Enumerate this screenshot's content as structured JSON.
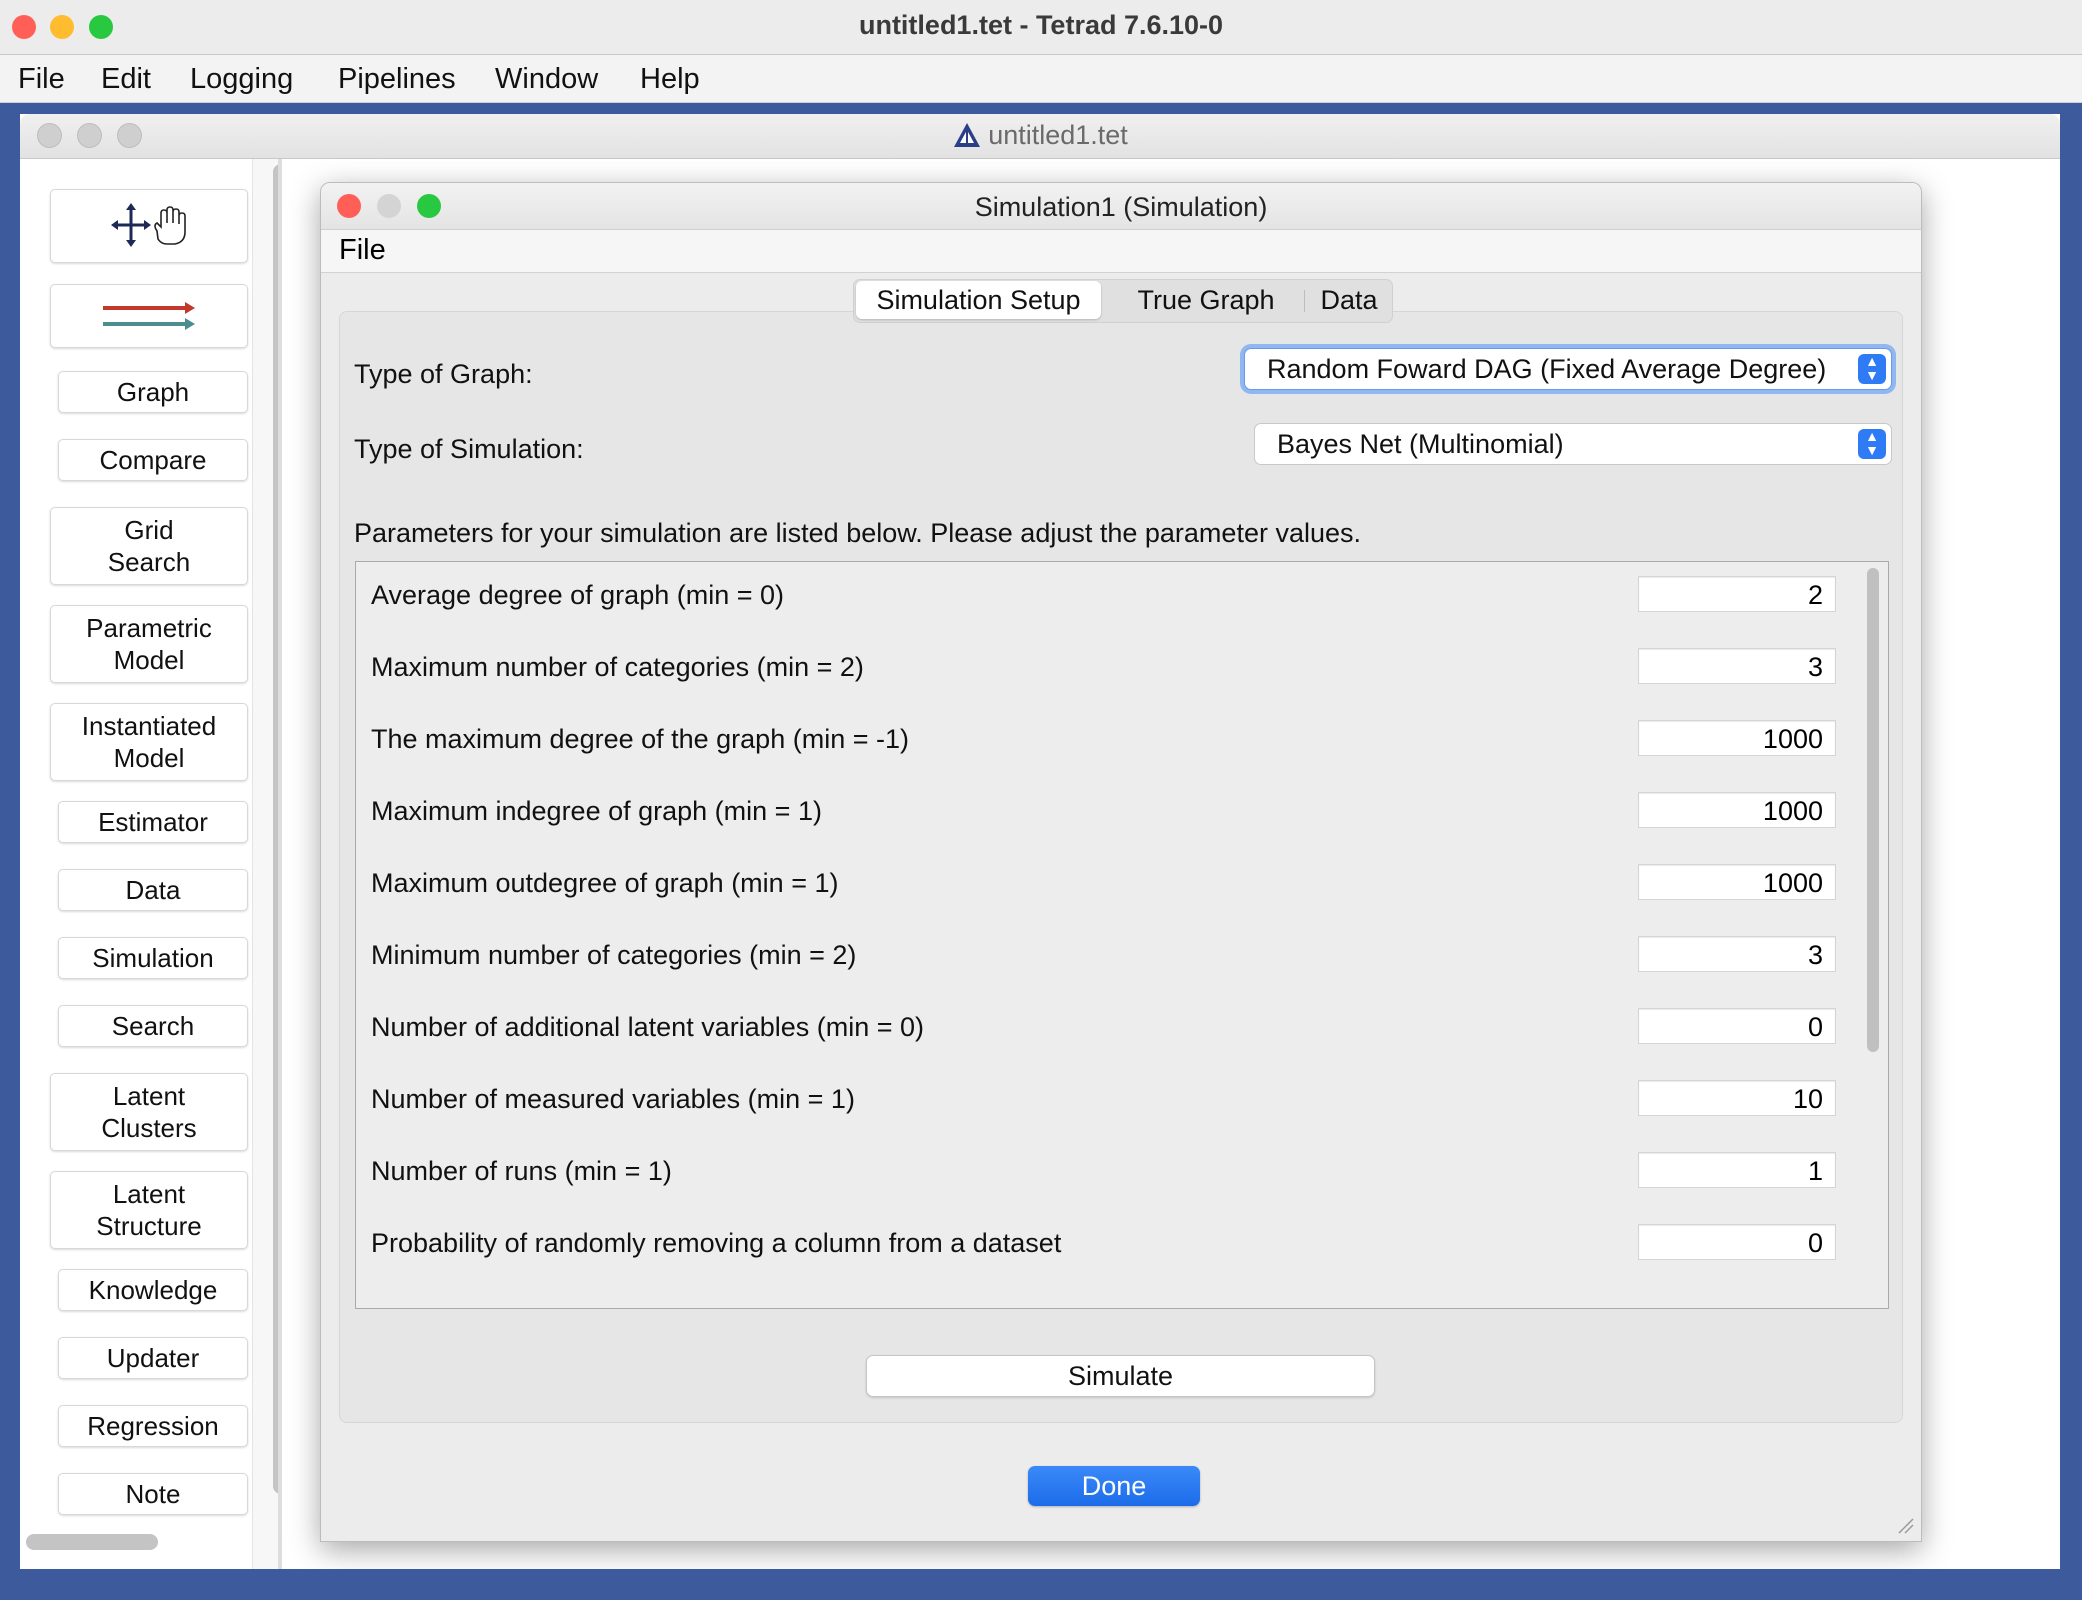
{
  "app": {
    "window_title": "untitled1.tet - Tetrad 7.6.10-0",
    "menu": [
      "File",
      "Edit",
      "Logging",
      "Pipelines",
      "Window",
      "Help"
    ]
  },
  "inner_frame": {
    "title": "untitled1.tet"
  },
  "toolbox": {
    "items": [
      {
        "line1": "Graph",
        "line2": ""
      },
      {
        "line1": "Compare",
        "line2": ""
      },
      {
        "line1": "Grid",
        "line2": "Search"
      },
      {
        "line1": "Parametric",
        "line2": "Model"
      },
      {
        "line1": "Instantiated",
        "line2": "Model"
      },
      {
        "line1": "Estimator",
        "line2": ""
      },
      {
        "line1": "Data",
        "line2": ""
      },
      {
        "line1": "Simulation",
        "line2": ""
      },
      {
        "line1": "Search",
        "line2": ""
      },
      {
        "line1": "Latent",
        "line2": "Clusters"
      },
      {
        "line1": "Latent",
        "line2": "Structure"
      },
      {
        "line1": "Knowledge",
        "line2": ""
      },
      {
        "line1": "Updater",
        "line2": ""
      },
      {
        "line1": "Regression",
        "line2": ""
      },
      {
        "line1": "Note",
        "line2": ""
      }
    ]
  },
  "dialog": {
    "title": "Simulation1 (Simulation)",
    "menu_file": "File",
    "tabs": [
      "Simulation Setup",
      "True Graph",
      "Data"
    ],
    "active_tab": "Simulation Setup",
    "graph_type_label": "Type of Graph:",
    "graph_type_value": "Random Foward DAG (Fixed Average Degree)",
    "sim_type_label": "Type of Simulation:",
    "sim_type_value": "Bayes Net (Multinomial)",
    "params_intro": "Parameters for your simulation are listed below. Please adjust the parameter values.",
    "params": [
      {
        "label": "Average degree of graph (min = 0)",
        "value": "2"
      },
      {
        "label": "Maximum number of categories (min = 2)",
        "value": "3"
      },
      {
        "label": "The maximum degree of the graph (min = -1)",
        "value": "1000"
      },
      {
        "label": "Maximum indegree of graph (min = 1)",
        "value": "1000"
      },
      {
        "label": "Maximum outdegree of graph (min = 1)",
        "value": "1000"
      },
      {
        "label": "Minimum number of categories (min = 2)",
        "value": "3"
      },
      {
        "label": "Number of additional latent variables (min = 0)",
        "value": "0"
      },
      {
        "label": "Number of measured variables (min = 1)",
        "value": "10"
      },
      {
        "label": "Number of runs (min = 1)",
        "value": "1"
      },
      {
        "label": "Probability of randomly removing a column from a dataset",
        "value": "0"
      }
    ],
    "simulate_label": "Simulate",
    "done_label": "Done"
  },
  "colors": {
    "accent": "#2f7bf5",
    "close": "#ff5f57",
    "minimize": "#febc2e",
    "zoom": "#28c840"
  }
}
